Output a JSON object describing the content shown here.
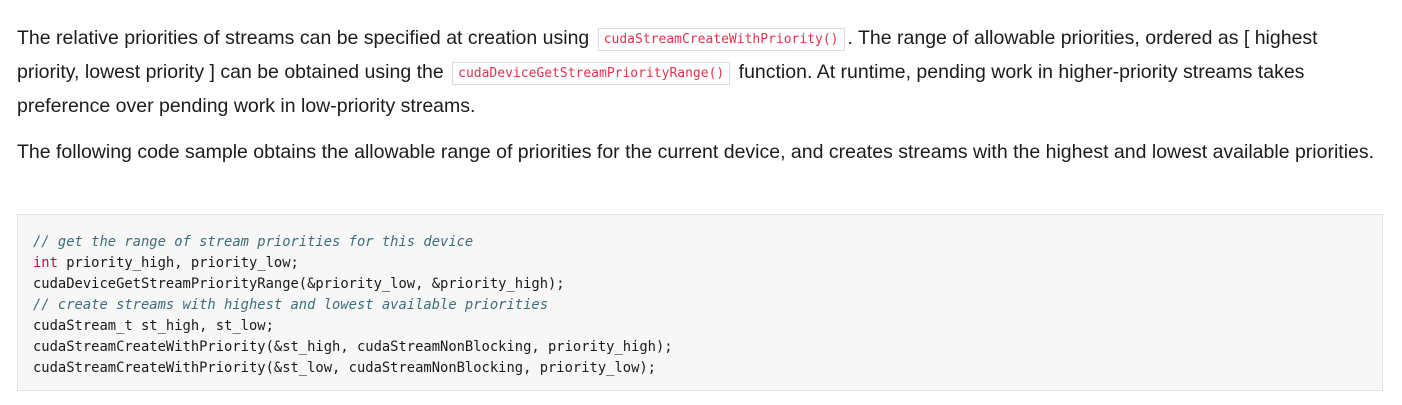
{
  "paragraph1": {
    "text1": "The relative priorities of streams can be specified at creation using",
    "code1": "cudaStreamCreateWithPriority()",
    "text2": ". The range of allowable priorities, ordered as [ highest priority, lowest priority ] can be obtained using the",
    "code2": "cudaDeviceGetStreamPriorityRange()",
    "text3": "function. At runtime, pending work in higher-priority streams takes preference over pending work in low-priority streams."
  },
  "paragraph2": {
    "text": "The following code sample obtains the allowable range of priorities for the current device, and creates streams with the highest and lowest available priorities."
  },
  "code_block": {
    "line1_comment": "// get the range of stream priorities for this device",
    "line2_keyword": "int",
    "line2_rest": " priority_high, priority_low;",
    "line3": "cudaDeviceGetStreamPriorityRange(&priority_low, &priority_high);",
    "line4_comment": "// create streams with highest and lowest available priorities",
    "line5": "cudaStream_t st_high, st_low;",
    "line6": "cudaStreamCreateWithPriority(&st_high, cudaStreamNonBlocking, priority_high);",
    "line7": "cudaStreamCreateWithPriority(&st_low, cudaStreamNonBlocking, priority_low);"
  }
}
